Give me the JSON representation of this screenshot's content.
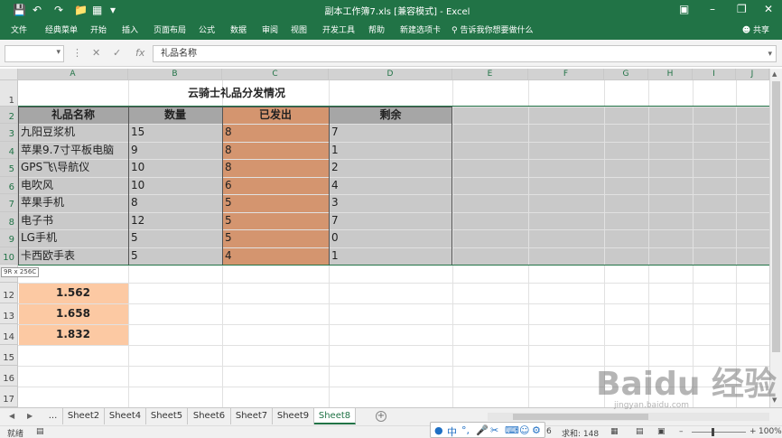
{
  "window": {
    "title": "副本工作簿7.xls  [兼容模式]  -  Excel"
  },
  "ribbon_tabs": [
    "文件",
    "经典菜单",
    "开始",
    "插入",
    "页面布局",
    "公式",
    "数据",
    "审阅",
    "视图",
    "开发工具",
    "帮助",
    "新建选项卡"
  ],
  "tell_me": "告诉我你想要做什么",
  "share": "共享",
  "formula_bar": {
    "name_box": "",
    "formula": "礼品名称"
  },
  "columns": [
    "A",
    "B",
    "C",
    "D",
    "E",
    "F",
    "G",
    "H",
    "I",
    "J"
  ],
  "rows": [
    "1",
    "2",
    "3",
    "4",
    "5",
    "6",
    "7",
    "8",
    "9",
    "10",
    "11",
    "12",
    "13",
    "14",
    "15",
    "16",
    "17"
  ],
  "sheet": {
    "title": "云骑士礼品分发情况",
    "headers": [
      "礼品名称",
      "数量",
      "已发出",
      "剩余"
    ],
    "data_rows": [
      [
        "九阳豆浆机",
        "15",
        "8",
        "7"
      ],
      [
        "苹果9.7寸平板电脑",
        "9",
        "8",
        "1"
      ],
      [
        "GPS飞\\导航仪",
        "10",
        "8",
        "2"
      ],
      [
        "电吹风",
        "10",
        "6",
        "4"
      ],
      [
        "苹果手机",
        "8",
        "5",
        "3"
      ],
      [
        "电子书",
        "12",
        "5",
        "7"
      ],
      [
        "LG手机",
        "5",
        "5",
        "0"
      ],
      [
        "卡西欧手表",
        "5",
        "4",
        "1"
      ]
    ],
    "extra_values": [
      "1.562",
      "1.658",
      "1.832"
    ]
  },
  "selection_tip": "9R x 256C",
  "sheet_tabs": [
    "...",
    "Sheet2",
    "Sheet4",
    "Sheet5",
    "Sheet6",
    "Sheet7",
    "Sheet9",
    "Sheet8"
  ],
  "active_sheet": "Sheet8",
  "status": {
    "mode": "就绪",
    "count_partial": "6",
    "sum": "求和: 148",
    "zoom": "100%"
  },
  "watermark": {
    "brand": "Baidu 经验",
    "url": "jingyan.baidu.com"
  },
  "colors": {
    "excel_green": "#217346",
    "header_gray": "#a6a6a6",
    "selection_gray": "#c9c9c9",
    "issued_orange": "#d4956f",
    "peach": "#fcc9a3"
  }
}
